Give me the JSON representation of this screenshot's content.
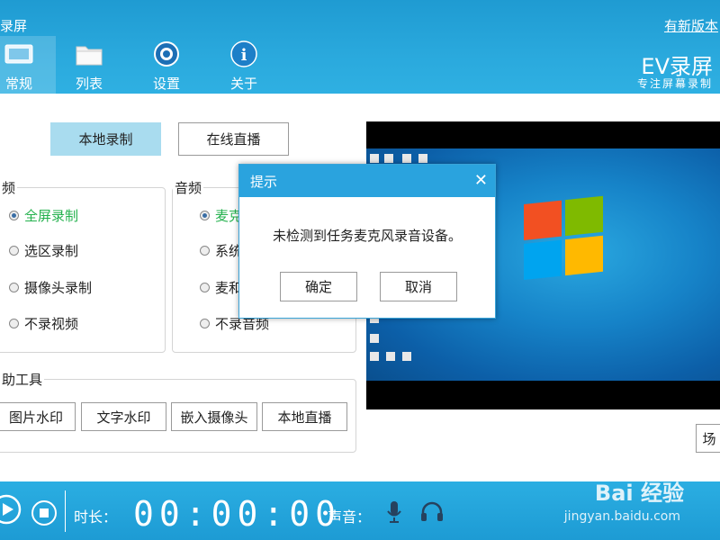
{
  "window": {
    "title": "录屏",
    "update_link": "有新版本"
  },
  "tabs": [
    {
      "label": "常规",
      "icon": "general-icon",
      "active": true
    },
    {
      "label": "列表",
      "icon": "folder-icon",
      "active": false
    },
    {
      "label": "设置",
      "icon": "gear-icon",
      "active": false
    },
    {
      "label": "关于",
      "icon": "info-icon",
      "active": false
    }
  ],
  "brand": {
    "name": "EV录屏",
    "tagline": "专注屏幕录制"
  },
  "mode_buttons": {
    "local": "本地录制",
    "live": "在线直播",
    "active": "local"
  },
  "video_group": {
    "title": "频",
    "options": [
      "全屏录制",
      "选区录制",
      "摄像头录制",
      "不录视频"
    ],
    "selected": 0
  },
  "audio_group": {
    "title": "音频",
    "options": [
      "麦克",
      "系统",
      "麦和",
      "不录音频"
    ],
    "selected": 0
  },
  "tools_group": {
    "title": "助工具",
    "buttons": [
      "图片水印",
      "文字水印",
      "嵌入摄像头",
      "本地直播"
    ]
  },
  "side_button": "场",
  "bottom_bar": {
    "duration_label": "时长：",
    "timer": "00:00:00",
    "sound_label": "声音："
  },
  "dialog": {
    "title": "提示",
    "message": "未检测到任务麦克风录音设备。",
    "ok": "确定",
    "cancel": "取消"
  },
  "watermark": {
    "brand": "Bai 经验",
    "url": "jingyan.baidu.com"
  },
  "colors": {
    "accent": "#2aa9dd",
    "active_tab": "#a9dcef",
    "selected_green": "#23b14d"
  }
}
